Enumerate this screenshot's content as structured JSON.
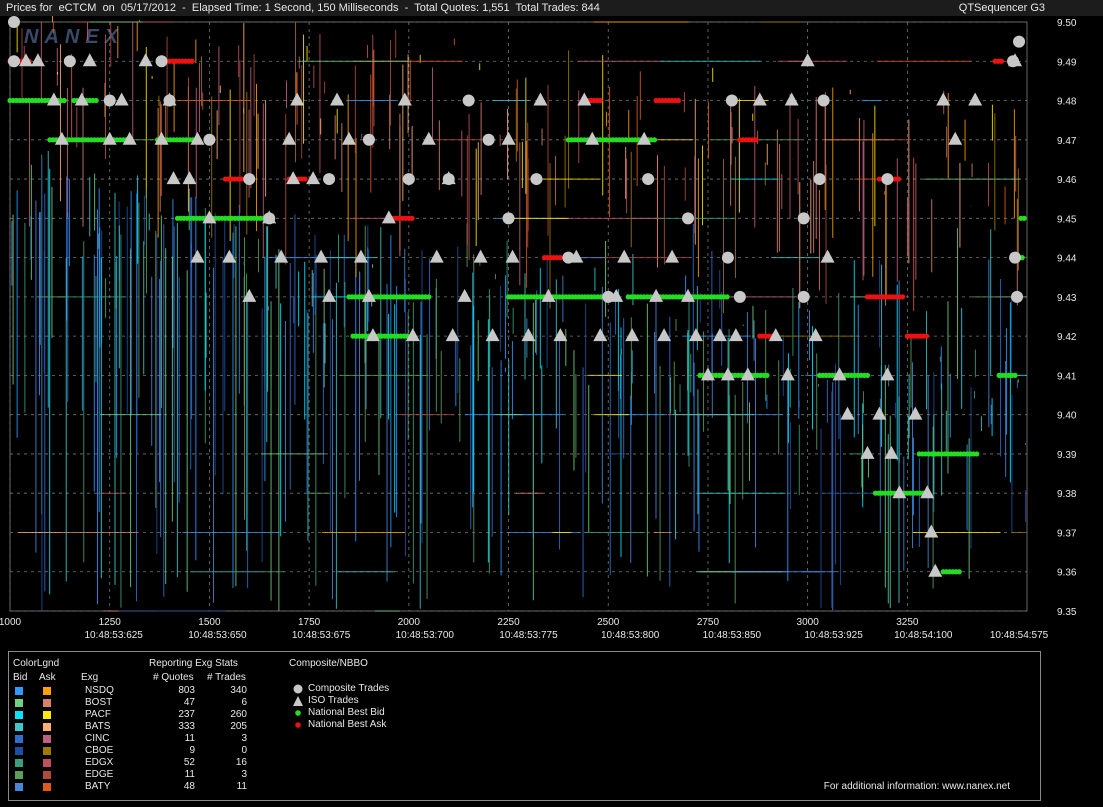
{
  "window": {
    "title": "Prices for  eCTCM  on  05/17/2012  -  Elapsed Time: 1 Second, 150 Milliseconds  -  Total Quotes: 1,551  Total Trades: 844",
    "app": "QTSequencer G3",
    "watermark": "NANEX"
  },
  "chart_data": {
    "type": "scatter",
    "x_ticks": [
      "1000",
      "1250",
      "1500",
      "1750",
      "2000",
      "2250",
      "2500",
      "2750",
      "3000",
      "3250"
    ],
    "x_tick_values": [
      1000,
      1250,
      1500,
      1750,
      2000,
      2250,
      2500,
      2750,
      3000,
      3250
    ],
    "time_labels": [
      {
        "x": 1260,
        "label": "10:48:53:625"
      },
      {
        "x": 1520,
        "label": "10:48:53:650"
      },
      {
        "x": 1780,
        "label": "10:48:53:675"
      },
      {
        "x": 2040,
        "label": "10:48:53:700"
      },
      {
        "x": 2300,
        "label": "10:48:53:775"
      },
      {
        "x": 2555,
        "label": "10:48:53:800"
      },
      {
        "x": 2810,
        "label": "10:48:53:850"
      },
      {
        "x": 3065,
        "label": "10:48:53:925"
      },
      {
        "x": 3290,
        "label": "10:48:54:100"
      },
      {
        "x": 3530,
        "label": "10:48:54:575"
      }
    ],
    "xlim": [
      1000,
      3550
    ],
    "y_ticks": [
      "9.50",
      "9.49",
      "9.48",
      "9.47",
      "9.46",
      "9.45",
      "9.44",
      "9.43",
      "9.42",
      "9.41",
      "9.40",
      "9.39",
      "9.38",
      "9.37",
      "9.36",
      "9.35"
    ],
    "ylim": [
      9.35,
      9.5
    ],
    "grid": true,
    "background": "#000000",
    "series": [
      {
        "name": "Composite Trades",
        "marker": "circle",
        "color": "#c8c8c8",
        "points": [
          [
            1010,
            9.5
          ],
          [
            1010,
            9.49
          ],
          [
            1150,
            9.49
          ],
          [
            1380,
            9.49
          ],
          [
            1250,
            9.48
          ],
          [
            1400,
            9.48
          ],
          [
            1500,
            9.47
          ],
          [
            1600,
            9.46
          ],
          [
            1650,
            9.45
          ],
          [
            1800,
            9.46
          ],
          [
            1900,
            9.47
          ],
          [
            2000,
            9.46
          ],
          [
            2100,
            9.46
          ],
          [
            2150,
            9.48
          ],
          [
            2200,
            9.47
          ],
          [
            2250,
            9.45
          ],
          [
            2320,
            9.46
          ],
          [
            2400,
            9.44
          ],
          [
            2500,
            9.43
          ],
          [
            2600,
            9.46
          ],
          [
            2700,
            9.45
          ],
          [
            2800,
            9.44
          ],
          [
            2810,
            9.48
          ],
          [
            2830,
            9.43
          ],
          [
            2990,
            9.43
          ],
          [
            2990,
            9.45
          ],
          [
            3030,
            9.46
          ],
          [
            3040,
            9.48
          ],
          [
            3200,
            9.46
          ],
          [
            3515,
            9.49
          ],
          [
            3520,
            9.44
          ],
          [
            3525,
            9.43
          ],
          [
            3530,
            9.495
          ]
        ]
      },
      {
        "name": "ISO Trades",
        "marker": "triangle",
        "color": "#c8c8c8",
        "points": [
          [
            1040,
            9.49
          ],
          [
            1070,
            9.49
          ],
          [
            1110,
            9.48
          ],
          [
            1130,
            9.47
          ],
          [
            1180,
            9.48
          ],
          [
            1200,
            9.49
          ],
          [
            1250,
            9.47
          ],
          [
            1280,
            9.48
          ],
          [
            1300,
            9.47
          ],
          [
            1340,
            9.49
          ],
          [
            1380,
            9.47
          ],
          [
            1400,
            9.48
          ],
          [
            1410,
            9.46
          ],
          [
            1450,
            9.46
          ],
          [
            1470,
            9.47
          ],
          [
            1500,
            9.45
          ],
          [
            1470,
            9.44
          ],
          [
            1550,
            9.44
          ],
          [
            1600,
            9.43
          ],
          [
            1650,
            9.45
          ],
          [
            1680,
            9.44
          ],
          [
            1700,
            9.47
          ],
          [
            1710,
            9.46
          ],
          [
            1720,
            9.48
          ],
          [
            1760,
            9.46
          ],
          [
            1780,
            9.44
          ],
          [
            1800,
            9.43
          ],
          [
            1820,
            9.48
          ],
          [
            1850,
            9.47
          ],
          [
            1880,
            9.44
          ],
          [
            1900,
            9.43
          ],
          [
            1910,
            9.42
          ],
          [
            1950,
            9.45
          ],
          [
            1990,
            9.48
          ],
          [
            2010,
            9.42
          ],
          [
            2050,
            9.47
          ],
          [
            2070,
            9.44
          ],
          [
            2100,
            9.46
          ],
          [
            2110,
            9.42
          ],
          [
            2140,
            9.43
          ],
          [
            2180,
            9.44
          ],
          [
            2210,
            9.42
          ],
          [
            2250,
            9.47
          ],
          [
            2260,
            9.44
          ],
          [
            2300,
            9.42
          ],
          [
            2330,
            9.48
          ],
          [
            2350,
            9.43
          ],
          [
            2380,
            9.42
          ],
          [
            2420,
            9.44
          ],
          [
            2440,
            9.48
          ],
          [
            2460,
            9.47
          ],
          [
            2480,
            9.42
          ],
          [
            2520,
            9.43
          ],
          [
            2540,
            9.44
          ],
          [
            2560,
            9.42
          ],
          [
            2590,
            9.47
          ],
          [
            2620,
            9.43
          ],
          [
            2640,
            9.42
          ],
          [
            2660,
            9.44
          ],
          [
            2700,
            9.43
          ],
          [
            2720,
            9.42
          ],
          [
            2750,
            9.41
          ],
          [
            2780,
            9.42
          ],
          [
            2800,
            9.41
          ],
          [
            2820,
            9.42
          ],
          [
            2850,
            9.41
          ],
          [
            2880,
            9.48
          ],
          [
            2920,
            9.42
          ],
          [
            2950,
            9.41
          ],
          [
            2960,
            9.48
          ],
          [
            3000,
            9.49
          ],
          [
            3020,
            9.42
          ],
          [
            3050,
            9.44
          ],
          [
            3080,
            9.41
          ],
          [
            3100,
            9.4
          ],
          [
            3150,
            9.39
          ],
          [
            3180,
            9.4
          ],
          [
            3200,
            9.41
          ],
          [
            3210,
            9.39
          ],
          [
            3230,
            9.38
          ],
          [
            3270,
            9.4
          ],
          [
            3300,
            9.38
          ],
          [
            3310,
            9.37
          ],
          [
            3320,
            9.36
          ],
          [
            3340,
            9.48
          ],
          [
            3370,
            9.47
          ],
          [
            3420,
            9.48
          ],
          [
            3520,
            9.49
          ]
        ]
      },
      {
        "name": "National Best Bid",
        "marker": "dot",
        "color": "#22dd22",
        "levels": [
          [
            1000,
            1140,
            9.48
          ],
          [
            1100,
            1300,
            9.47
          ],
          [
            1160,
            1220,
            9.48
          ],
          [
            1370,
            1460,
            9.47
          ],
          [
            1420,
            1650,
            9.45
          ],
          [
            1850,
            2050,
            9.43
          ],
          [
            1860,
            2000,
            9.42
          ],
          [
            2250,
            2500,
            9.43
          ],
          [
            2400,
            2620,
            9.47
          ],
          [
            2550,
            2800,
            9.43
          ],
          [
            2730,
            2900,
            9.41
          ],
          [
            3030,
            3150,
            9.41
          ],
          [
            3170,
            3290,
            9.38
          ],
          [
            3280,
            3430,
            9.39
          ],
          [
            3340,
            3380,
            9.36
          ],
          [
            3480,
            3520,
            9.41
          ],
          [
            3530,
            3540,
            9.44
          ],
          [
            3535,
            3545,
            9.45
          ]
        ]
      },
      {
        "name": "National Best Ask",
        "marker": "dot",
        "color": "#ee1111",
        "levels": [
          [
            1000,
            1050,
            9.49
          ],
          [
            1400,
            1460,
            9.49
          ],
          [
            1540,
            1590,
            9.46
          ],
          [
            1700,
            1740,
            9.46
          ],
          [
            1960,
            2010,
            9.45
          ],
          [
            2340,
            2380,
            9.44
          ],
          [
            2440,
            2480,
            9.48
          ],
          [
            2620,
            2680,
            9.48
          ],
          [
            2830,
            2870,
            9.47
          ],
          [
            2880,
            2920,
            9.42
          ],
          [
            3150,
            3240,
            9.43
          ],
          [
            3180,
            3230,
            9.46
          ],
          [
            3250,
            3300,
            9.42
          ],
          [
            3470,
            3490,
            9.49
          ]
        ]
      }
    ]
  },
  "legend": {
    "title": "ColorLgnd",
    "bid_header": "Bid",
    "ask_header": "Ask",
    "exg_header": "Exg",
    "stats_title": "Reporting Exg Stats",
    "quotes_header": "# Quotes",
    "trades_header": "# Trades",
    "nbbo_title": "Composite/NBBO",
    "rows": [
      {
        "exg": "NSDQ",
        "quotes": "803",
        "trades": "340",
        "bid_color": "#2e9bff",
        "ask_color": "#ff9f00"
      },
      {
        "exg": "BOST",
        "quotes": "47",
        "trades": "6",
        "bid_color": "#6fd17f",
        "ask_color": "#d88070"
      },
      {
        "exg": "PACF",
        "quotes": "237",
        "trades": "260",
        "bid_color": "#00e5ff",
        "ask_color": "#ffea00"
      },
      {
        "exg": "BATS",
        "quotes": "333",
        "trades": "205",
        "bid_color": "#40c8c8",
        "ask_color": "#ffb070"
      },
      {
        "exg": "CINC",
        "quotes": "11",
        "trades": "3",
        "bid_color": "#2f6fd0",
        "ask_color": "#c06080"
      },
      {
        "exg": "CBOE",
        "quotes": "9",
        "trades": "0",
        "bid_color": "#1f4fa0",
        "ask_color": "#a07a00"
      },
      {
        "exg": "EDGX",
        "quotes": "52",
        "trades": "16",
        "bid_color": "#35a07a",
        "ask_color": "#c05060"
      },
      {
        "exg": "EDGE",
        "quotes": "11",
        "trades": "3",
        "bid_color": "#5aa05a",
        "ask_color": "#b04a3a"
      },
      {
        "exg": "BATY",
        "quotes": "48",
        "trades": "11",
        "bid_color": "#4a86d8",
        "ask_color": "#e05a20"
      }
    ],
    "nbbo_items": [
      {
        "label": "Composite Trades",
        "symbol": "circle",
        "color": "#c8c8c8"
      },
      {
        "label": "ISO Trades",
        "symbol": "triangle",
        "color": "#c8c8c8"
      },
      {
        "label": "National Best Bid",
        "symbol": "dot",
        "color": "#22dd22"
      },
      {
        "label": "National Best Ask",
        "symbol": "dot",
        "color": "#ee1111"
      }
    ],
    "footer": "For additional information: www.nanex.net"
  }
}
